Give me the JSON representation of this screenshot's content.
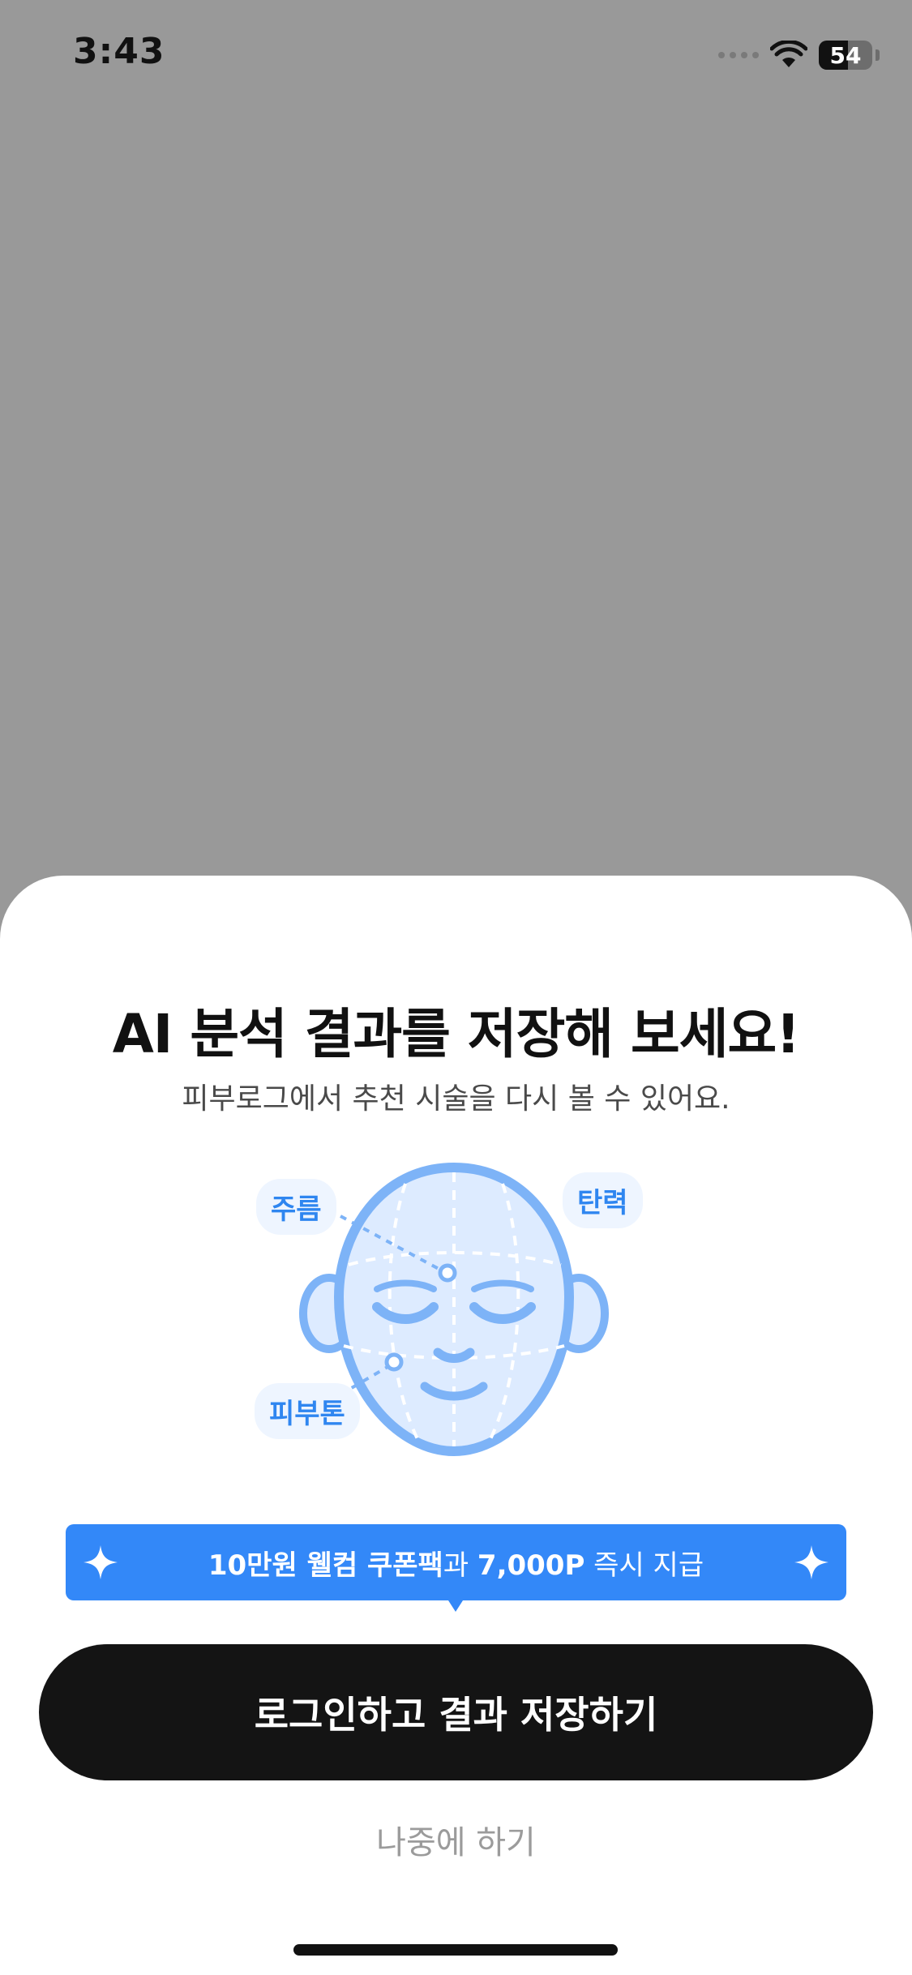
{
  "status_bar": {
    "time": "3:43",
    "battery_level": "54",
    "battery_fraction": 0.54
  },
  "sheet": {
    "title": "AI 분석 결과를 저장해 보세요!",
    "subtitle": "피부로그에서 추천 시술을 다시 볼 수 있어요.",
    "tags": {
      "wrinkle": "주름",
      "elasticity": "탄력",
      "skin_tone": "피부톤"
    },
    "promo": {
      "part1": "10만원 웰컴 쿠폰팩",
      "part2": "과 ",
      "part3": "7,000P",
      "part4": " 즉시 지급"
    },
    "login_button_label": "로그인하고 결과 저장하기",
    "later_label": "나중에 하기"
  },
  "colors": {
    "accent": "#3388F8",
    "face_fill": "#DDEBFF",
    "face_stroke": "#7DB3F7",
    "button": "#141414",
    "backdrop": "#999999"
  },
  "icons": [
    "wifi-icon",
    "battery-icon",
    "sparkle-icon",
    "face-illustration"
  ]
}
